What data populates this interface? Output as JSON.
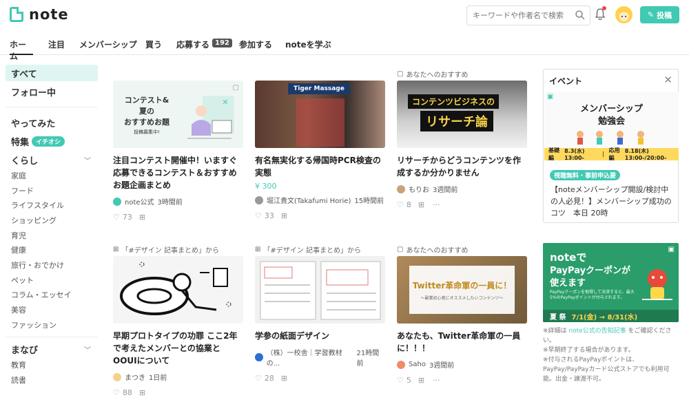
{
  "header": {
    "logo": "note",
    "search_placeholder": "キーワードや作者名で検索",
    "post_label": "投稿"
  },
  "tabs": [
    {
      "label": "ホーム"
    },
    {
      "label": "注目"
    },
    {
      "label": "メンバーシップ"
    },
    {
      "label": "買う"
    },
    {
      "label": "応募する",
      "badge": "192"
    },
    {
      "label": "参加する"
    },
    {
      "label": "noteを学ぶ"
    }
  ],
  "sidebar": {
    "top": [
      "すべて",
      "フォロー中"
    ],
    "yattemita": "やってみた",
    "tokushu": "特集",
    "ichioshi": "イチオシ",
    "kurashi": "くらし",
    "kurashi_items": [
      "家庭",
      "フード",
      "ライフスタイル",
      "ショッピング",
      "育児",
      "健康",
      "旅行・おでかけ",
      "ペット",
      "コラム・エッセイ",
      "美容",
      "ファッション"
    ],
    "manabi": "まなび",
    "manabi_items": [
      "教育",
      "読書"
    ]
  },
  "cards": [
    {
      "from": "",
      "title": "注目コンテスト開催中！いますぐ応募できるコンテスト＆おすすめお題企画まとめ",
      "price": "",
      "author": "note公式",
      "time": "3時間前",
      "likes": "73",
      "thumb": {
        "line1": "コンテスト&",
        "line2": "夏の",
        "line3": "おすすめお題",
        "sub": "投稿募集中!"
      }
    },
    {
      "from": "",
      "title": "有名無実化する帰国時PCR検査の実態",
      "price": "¥ 300",
      "author": "堀江貴文(Takafumi Horie)",
      "time": "15時間前",
      "likes": "33",
      "thumb": {
        "sign": "Tiger Massage"
      }
    },
    {
      "from": "あなたへのおすすめ",
      "title": "リサーチからどうコンテンツを作成するか分かりません",
      "price": "",
      "author": "もりお",
      "time": "3週間前",
      "likes": "8",
      "thumb": {
        "line1": "コンテンツビジネスの",
        "line2": "リサーチ論"
      }
    },
    {
      "from": "「#デザイン 記事まとめ」から",
      "title": "早期プロトタイプの功罪 ここ2年で考えたメンバーとの協業とOOUIについて",
      "price": "",
      "author": "まつき",
      "time": "1日前",
      "likes": "88"
    },
    {
      "from": "「#デザイン 記事まとめ」から",
      "title": "学参の紙面デザイン",
      "price": "",
      "author": "（株）一校舎｜学習教材の...",
      "time": "21時間前",
      "likes": "28"
    },
    {
      "from": "あなたへのおすすめ",
      "title": "あなたも、Twitter革命軍の一員に！！！",
      "price": "",
      "author": "Saho",
      "time": "3週間前",
      "likes": "5",
      "thumb": {
        "line1": "Twitter革命軍の一員に！",
        "sub": "〜副業初心者にオススメしたいコンテンツ〜"
      }
    }
  ],
  "event": {
    "title": "イベント",
    "banner_line1": "メンバーシップ",
    "banner_line2": "勉強会",
    "bar_a": "基礎編",
    "bar_a_date": "8.3(水) 13:00-",
    "bar_b": "応用編",
    "bar_b_date": "8.18(木) 13:00-/20:00-",
    "tag": "視聴無料・事前申込要",
    "text": "【noteメンバーシップ開設/検討中の人必見！】メンバーシップ成功のコツ　本日 20時"
  },
  "paypay": {
    "line1": "noteで",
    "line2": "PayPayクーポンが",
    "line3": "使えます",
    "small": "PayPayクーポンを取得して決済すると、最大5%のPayPayポイントが付与されます。",
    "date": "7/1(金) → 8/31(水)",
    "fest": "夏 祭"
  },
  "notes": {
    "n1a": "※詳細は ",
    "n1link": "note公式の告知記事",
    "n1b": " をご確認ください。",
    "n2": "※早期終了する場合があります。",
    "n3": "※付与されるPayPayポイントは、PayPay/PayPayカード公式ストアでも利用可能。出金・譲渡不可。"
  }
}
